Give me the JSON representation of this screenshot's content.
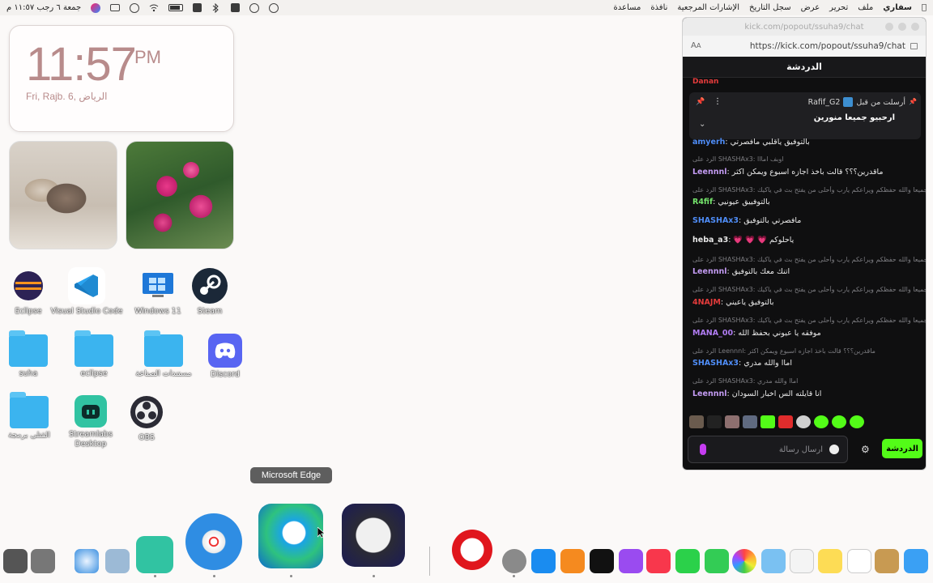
{
  "menubar": {
    "app_name": "سفاري",
    "menus": [
      "ملف",
      "تحرير",
      "عرض",
      "سجل التاريخ",
      "الإشارات المرجعية",
      "نافذة",
      "مساعدة"
    ],
    "clock": "جمعة ٦ رجب ١١:٥٧ م"
  },
  "clock_widget": {
    "time": "11:57",
    "ampm": "PM",
    "date": "Fri, Rajb. 6,",
    "city": "الرياض"
  },
  "desktop_icons": [
    {
      "label": "Eclipse"
    },
    {
      "label": "Visual Studio Code"
    },
    {
      "label": "Windows 11"
    },
    {
      "label": "Steam"
    },
    {
      "label": "suha"
    },
    {
      "label": "eclipse"
    },
    {
      "label": "مستندات الصناعة"
    },
    {
      "label": "Discord"
    },
    {
      "label": "القتلى برمجة"
    },
    {
      "label": "Streamlabs Desktop"
    },
    {
      "label": "OBS"
    }
  ],
  "chat": {
    "window_title": "kick.com/popout/ssuha9/chat",
    "url": "https://kick.com/popout/ssuha9/chat",
    "header": "الدردشة",
    "cut_top_user": "Danan",
    "pinned": {
      "meta": "أرسلت من قبل",
      "user": "Rafif_G2",
      "text": "ارحبيو جميعا منورين"
    },
    "messages": [
      {
        "kind": "msg",
        "user": "amyerh",
        "color": "#4f8df7",
        "text": ": بالتوفيق ياقلبي مافصرتي"
      },
      {
        "kind": "reply",
        "text": "الرد على SHASHAx3: اوبف امااا"
      },
      {
        "kind": "msg",
        "user": "Leennnl",
        "color": "#c39bf2",
        "text": ": ماقدرين؟؟؟ قالت باخذ اجازه اسبوع ويمكن اكثر"
      },
      {
        "kind": "reply",
        "text": "الرد على SHASHAx3: انا استاذتكم جميعا والله حفظكم ويراعكم يارب وأحلى من يفتح بث في ياكيك ..."
      },
      {
        "kind": "msg",
        "user": "R4fif",
        "color": "#74e36b",
        "text": ": بالتوفييق عيونيي"
      },
      {
        "kind": "msg",
        "user": "SHASHAx3",
        "color": "#4f8df7",
        "text": ": مافصرتي بالتوفيق"
      },
      {
        "kind": "msg",
        "user": "heba_a3",
        "color": "#e8e8e8",
        "text": ": 💗 💗 💗 ياحلوكم"
      },
      {
        "kind": "reply",
        "text": "الرد على SHASHAx3: انا استاذتكم جميعا والله حفظكم ويراعكم يارب وأحلى من يفتح بث في ياكيك ..."
      },
      {
        "kind": "msg",
        "user": "Leennnl",
        "color": "#c39bf2",
        "text": ": اتنك معك بالتوفيق"
      },
      {
        "kind": "reply",
        "text": "الرد على SHASHAx3: انا استاذتكم جميعا والله حفظكم ويراعكم يارب وأحلى من يفتح بث في ياكيك ..."
      },
      {
        "kind": "msg",
        "user": "4NAJM",
        "color": "#e33b3b",
        "text": ": بالتوفيق ياعيني"
      },
      {
        "kind": "reply",
        "text": "الرد على SHASHAx3: انا استاذتكم جميعا والله حفظكم ويراعكم يارب وأحلى من يفتح بث في ياكيك ..."
      },
      {
        "kind": "msg",
        "user": "MANA_00",
        "color": "#b07cf2",
        "text": ": موفقه يا عيوني بحفظ الله"
      },
      {
        "kind": "reply",
        "text": "الرد على Leennnl: ماقدرين؟؟؟ قالت باخذ اجازه اسبوع ويمكن اكثر"
      },
      {
        "kind": "msg",
        "user": "SHASHAx3",
        "color": "#4f8df7",
        "text": ": اماا والله مدري"
      },
      {
        "kind": "reply",
        "text": "الرد على SHASHAx3: اماا والله مدري"
      },
      {
        "kind": "msg",
        "user": "Leennnl",
        "color": "#c39bf2",
        "text": ": انا قايلته الس اخبار السودان"
      }
    ],
    "input_placeholder": "ارسال رسالة",
    "send_label": "الدردشة"
  },
  "dock": {
    "tooltip": "Microsoft Edge"
  },
  "colors": {
    "kick_green": "#53fc18",
    "chat_bg": "#0f0f10",
    "clock_text": "#b88b8b"
  }
}
